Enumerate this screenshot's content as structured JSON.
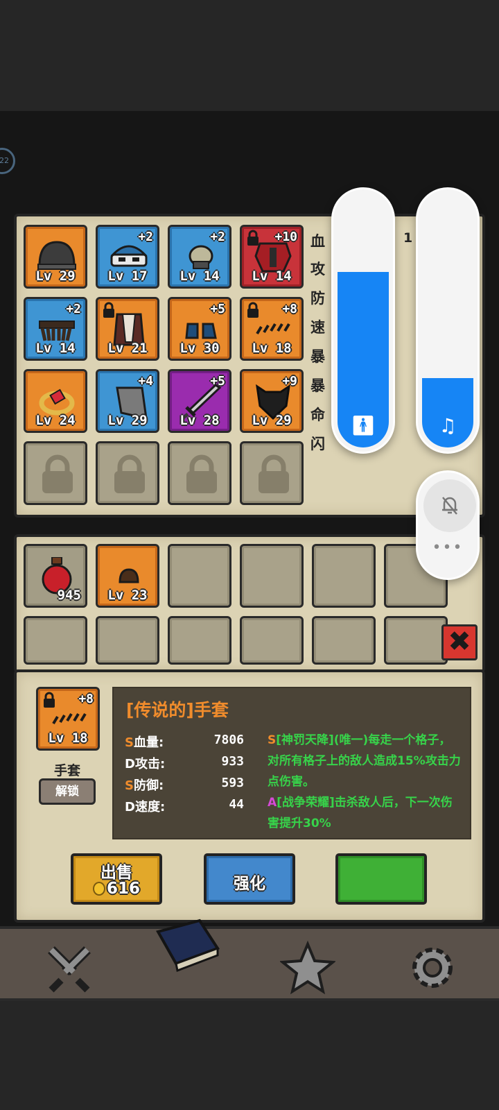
{
  "side_badge": "22",
  "equipment": [
    {
      "level": "Lv 29",
      "plus": "",
      "locked": false,
      "rarity": "orange",
      "icon": "helmet-icon"
    },
    {
      "level": "Lv 17",
      "plus": "+2",
      "locked": false,
      "rarity": "blue",
      "icon": "bandana-mask-icon"
    },
    {
      "level": "Lv 14",
      "plus": "+2",
      "locked": false,
      "rarity": "blue",
      "icon": "pauldron-icon"
    },
    {
      "level": "Lv 14",
      "plus": "+10",
      "locked": true,
      "rarity": "red",
      "icon": "red-armor-icon"
    },
    {
      "level": "Lv 14",
      "plus": "+2",
      "locked": false,
      "rarity": "blue",
      "icon": "belt-icon"
    },
    {
      "level": "Lv 21",
      "plus": "",
      "locked": true,
      "rarity": "orange",
      "icon": "cape-icon"
    },
    {
      "level": "Lv 30",
      "plus": "+5",
      "locked": false,
      "rarity": "orange",
      "icon": "boots-icon"
    },
    {
      "level": "Lv 18",
      "plus": "+8",
      "locked": true,
      "rarity": "orange",
      "icon": "claw-glove-icon"
    },
    {
      "level": "Lv 24",
      "plus": "",
      "locked": false,
      "rarity": "orange",
      "icon": "ring-icon"
    },
    {
      "level": "Lv 29",
      "plus": "+4",
      "locked": false,
      "rarity": "blue",
      "icon": "cloak-icon"
    },
    {
      "level": "Lv 28",
      "plus": "+5",
      "locked": false,
      "rarity": "purple",
      "icon": "sword-icon"
    },
    {
      "level": "Lv 29",
      "plus": "+9",
      "locked": false,
      "rarity": "orange",
      "icon": "dark-shield-icon"
    }
  ],
  "stats_labels": [
    "血",
    "攻",
    "防",
    "速",
    "暴",
    "暴",
    "命",
    "闪"
  ],
  "stats_first_value": "1",
  "bag": [
    {
      "count": "945",
      "rarity": "grey",
      "icon": "health-potion-icon"
    },
    {
      "level": "Lv 23",
      "rarity": "orange",
      "icon": "small-helmet-icon"
    }
  ],
  "detail": {
    "item_level": "Lv 18",
    "item_plus": "+8",
    "item_name": "手套",
    "unlock_label": "解锁",
    "title": "[传说的]手套",
    "stats": [
      {
        "tier": "S",
        "label": "血量:",
        "value": "7806"
      },
      {
        "tier": "D",
        "label": "攻击:",
        "value": "933"
      },
      {
        "tier": "S",
        "label": "防御:",
        "value": "593"
      },
      {
        "tier": "D",
        "label": "速度:",
        "value": "44"
      }
    ],
    "skill1_tier": "S",
    "skill1_text": "[神罚天降](唯一)每走一个格子，对所有格子上的敌人造成15%攻击力点伤害。",
    "skill2_tier": "A",
    "skill2_text": "[战争荣耀]击杀敌人后，下一次伤害提升30%"
  },
  "actions": {
    "sell_label": "出售",
    "sell_price": "616",
    "upgrade_label": "强化",
    "third_label": ""
  },
  "volume": {
    "accessibility_level": 0.68,
    "music_level": 0.27
  },
  "more_label": "•••",
  "nav": [
    "battle-swords-icon",
    "spellbook-icon",
    "star-icon",
    "settings-gear-icon"
  ]
}
